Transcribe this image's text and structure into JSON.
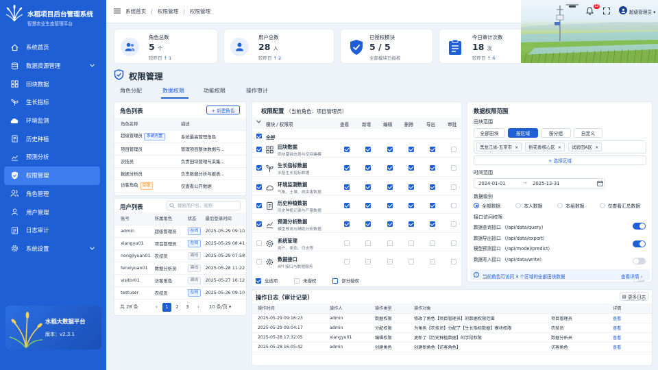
{
  "app": {
    "title": "水稻项目后台管理系统",
    "subtitle": "智慧农业生态管理平台",
    "platform_name": "水稻大数据平台",
    "version_label": "版本：",
    "version": "v2.3.1"
  },
  "sidebar": {
    "items": [
      {
        "label": "系统首页",
        "icon": "home-icon"
      },
      {
        "label": "数据资源管理",
        "icon": "database-icon",
        "has_caret": true
      },
      {
        "label": "田块数据",
        "icon": "grid-icon"
      },
      {
        "label": "生长指标",
        "icon": "plant-icon"
      },
      {
        "label": "环境监测",
        "icon": "cloud-icon"
      },
      {
        "label": "历史种植",
        "icon": "history-doc-icon"
      },
      {
        "label": "预测分析",
        "icon": "trend-chart-icon"
      },
      {
        "label": "权限管理",
        "icon": "shield-icon",
        "active": true
      },
      {
        "label": "角色管理",
        "icon": "users-icon"
      },
      {
        "label": "用户管理",
        "icon": "user-icon"
      },
      {
        "label": "日志审计",
        "icon": "log-icon"
      },
      {
        "label": "系统设置",
        "icon": "gear-icon",
        "has_caret": true
      }
    ]
  },
  "header": {
    "breadcrumbs": [
      "系统首页",
      "权限管理",
      "权限管理"
    ],
    "notification_count": "12",
    "user_name": "超级管理员"
  },
  "stats": [
    {
      "label": "角色总数",
      "value": "5",
      "unit": "个",
      "trend_label": "较昨日",
      "trend": "↑ 1",
      "icon": "users-icon"
    },
    {
      "label": "用户总数",
      "value": "28",
      "unit": "人",
      "trend_label": "较昨日",
      "trend": "↑ 2",
      "icon": "user-icon"
    },
    {
      "label": "已授权模块",
      "value": "5 / 5",
      "unit": "",
      "trend_label": "全部模块已授权",
      "trend": "",
      "icon": "shield-check-icon"
    },
    {
      "label": "今日审计次数",
      "value": "18",
      "unit": "次",
      "trend_label": "较昨日",
      "trend": "↑ 6",
      "icon": "clipboard-icon"
    }
  ],
  "page": {
    "title": "权限管理",
    "tabs": [
      "角色分配",
      "数据权限",
      "功能权限",
      "操作审计"
    ],
    "active_tab": 1
  },
  "roles": {
    "title": "角色列表",
    "new_button": "+ 新建角色",
    "columns": [
      "角色名称",
      "描述"
    ],
    "rows": [
      {
        "name": "超级管理员",
        "tag": "系统内置",
        "tag_color": "blue",
        "desc": "系统最高管理角色"
      },
      {
        "name": "项目管理员",
        "tag": "",
        "desc": "管理项目整体数据与..."
      },
      {
        "name": "农技员",
        "tag": "",
        "desc": "负责田块管理与采集..."
      },
      {
        "name": "数据分析员",
        "tag": "",
        "desc": "负责数据分析与报表..."
      },
      {
        "name": "访客角色",
        "tag": "受限",
        "tag_color": "orange",
        "desc": "仅查看公开数据"
      }
    ]
  },
  "users": {
    "title": "用户列表",
    "search_placeholder": "搜索用户名、昵称",
    "columns": [
      "账号",
      "所属角色",
      "状态",
      "最后登录时间"
    ],
    "rows": [
      {
        "account": "admin",
        "role": "超级管理员",
        "status": "在线",
        "last_login": "2025-05-29 09:10"
      },
      {
        "account": "xiangyu01",
        "role": "项目管理员",
        "status": "在线",
        "last_login": "2025-05-29 08:41"
      },
      {
        "account": "nongjiyuan01",
        "role": "农技员",
        "status": "离线",
        "last_login": "2025-05-29 07:58"
      },
      {
        "account": "fenxiyuan01",
        "role": "数据分析员",
        "status": "离线",
        "last_login": "2025-05-28 11:22"
      },
      {
        "account": "visitor01",
        "role": "访客角色",
        "status": "离线",
        "last_login": "2025-05-27 16:12"
      },
      {
        "account": "testuser",
        "role": "农技员",
        "status": "在线",
        "last_login": "2025-05-26 09:10"
      }
    ],
    "total": "共 28 条",
    "pages": [
      "1",
      "2",
      "3"
    ],
    "current_page": "1",
    "page_size": "10 条/页"
  },
  "perm": {
    "title": "权限配置",
    "current_role": "（当前角色：项目管理员）",
    "columns": [
      "模块 / 权限项",
      "查看",
      "新增",
      "编辑",
      "删除",
      "导出",
      "审批"
    ],
    "all_label": "全部",
    "rows": [
      {
        "name": "田块数据",
        "desc": "田块基础信息与空间建模",
        "icon": "grid-icon",
        "checked": true,
        "perms": [
          true,
          true,
          true,
          true,
          true,
          false
        ]
      },
      {
        "name": "生长指标数据",
        "desc": "水稻生长指标数据",
        "icon": "plant-icon",
        "checked": true,
        "perms": [
          true,
          true,
          true,
          true,
          true,
          false
        ]
      },
      {
        "name": "环境监测数据",
        "desc": "气象、土壤、病虫害数据",
        "icon": "cloud-icon",
        "checked": true,
        "perms": [
          true,
          true,
          true,
          true,
          true,
          false
        ]
      },
      {
        "name": "历史种植数据",
        "desc": "历史种植记录与产量数据",
        "icon": "history-doc-icon",
        "checked": true,
        "perms": [
          true,
          true,
          true,
          true,
          true,
          false
        ]
      },
      {
        "name": "预测分析数据",
        "desc": "模型预测与辅助分析数据",
        "icon": "trend-chart-icon",
        "checked": true,
        "perms": [
          true,
          true,
          true,
          true,
          true,
          false
        ]
      },
      {
        "name": "系统管理",
        "desc": "用户、角色、日志等",
        "icon": "gear-icon",
        "checked": false,
        "perms": [
          false,
          false,
          false,
          false,
          false,
          false
        ]
      },
      {
        "name": "数据接口",
        "desc": "API 接口与数据服务",
        "icon": "api-icon",
        "checked": false,
        "perms": [
          false,
          false,
          false,
          false,
          false,
          false
        ]
      }
    ],
    "legend": [
      "全选项",
      "未授权",
      "部分授权"
    ]
  },
  "scope": {
    "title": "数据权限范围",
    "field_scope_label": "田块范围",
    "field_options": [
      "全部田块",
      "按区域",
      "按分组",
      "自定义"
    ],
    "field_selected": "按区域",
    "regions": [
      "黑龙江省-五常市",
      "稻花香核心区",
      "试验田A区"
    ],
    "select_region": "+ 选择区域",
    "time_label": "时间范围",
    "date_start": "2024-01-01",
    "date_end": "2025-12-31",
    "level_label": "数据级别",
    "levels": [
      "全部数据",
      "本人数据",
      "本组数据",
      "仅查看汇总数据"
    ],
    "level_selected": "全部数据",
    "api_label": "接口访问权限",
    "apis": [
      {
        "label": "数据查询接口 （/api/data/query）",
        "on": true
      },
      {
        "label": "数据导出接口 （/api/data/export）",
        "on": true
      },
      {
        "label": "模型预测接口 （/api/model/predict）",
        "on": false
      },
      {
        "label": "数据写入接口 （/api/data/write）",
        "on": false
      }
    ],
    "info_text": "当前角色可访问 3 个区域的全部田块数据",
    "info_link": "查看详情 ›"
  },
  "log": {
    "title": "操作日志（审计记录）",
    "more_button": "更多日志",
    "columns": [
      "操作时间",
      "操作人",
      "操作类型",
      "操作对象",
      "",
      "详情"
    ],
    "rows": [
      {
        "time": "2025-05-29 09:16:23",
        "user": "admin",
        "type": "数据权限",
        "object": "修改了角色【项目管理员】的数据权限范围",
        "target": "项目管理员",
        "detail": "查看"
      },
      {
        "time": "2025-05-29 09:04:17",
        "user": "admin",
        "type": "分配权限",
        "object": "为角色【农技员】分配了【生长指标数据】模块权限",
        "target": "农技员",
        "detail": "查看"
      },
      {
        "time": "2025-05-28 17:32:05",
        "user": "xiangyu01",
        "type": "编辑权限",
        "object": "更新了【历史种植数据】的字段权限",
        "target": "数据分析员",
        "detail": "查看"
      },
      {
        "time": "2025-05-28 16:05:42",
        "user": "admin",
        "type": "创建角色",
        "object": "创建新角色【访客角色】",
        "target": "访客角色",
        "detail": "查看"
      }
    ]
  },
  "colors": {
    "primary": "#1f5fd6",
    "sidebar": "#1f5fd6",
    "active": "#3d7df0",
    "orange": "#fa8c16",
    "danger": "#f5222d"
  }
}
